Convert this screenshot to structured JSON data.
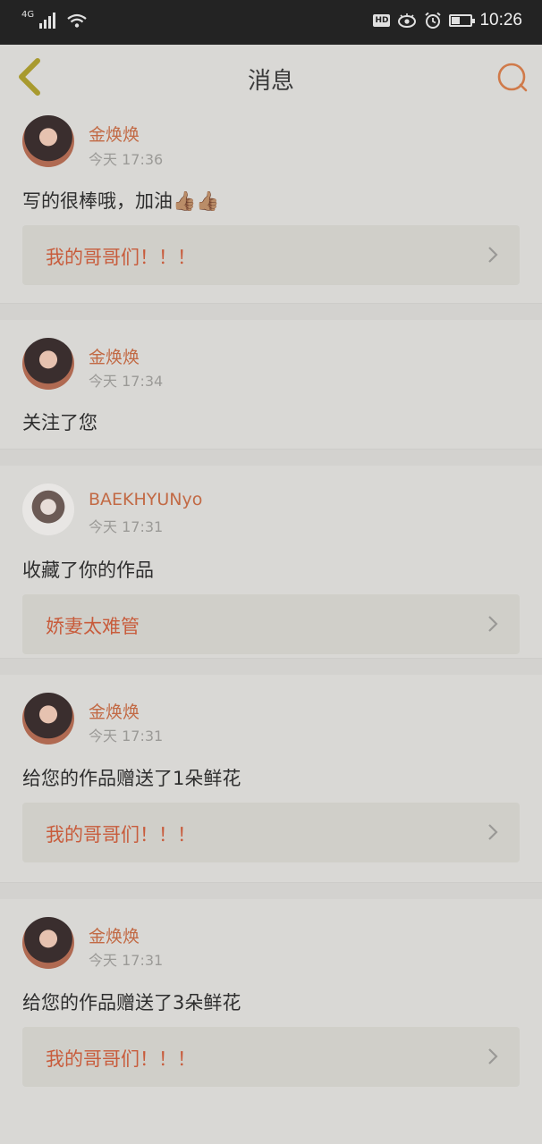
{
  "status_bar": {
    "network": "4G",
    "hd_badge": "HD",
    "time": "10:26"
  },
  "header": {
    "title": "消息"
  },
  "messages": [
    {
      "username": "金焕焕",
      "time": "今天 17:36",
      "text": "写的很棒哦，加油👍🏽👍🏽",
      "work_title": "我的哥哥们！！！"
    },
    {
      "username": "金焕焕",
      "time": "今天 17:34",
      "text": "关注了您"
    },
    {
      "username": "BAEKHYUNyo",
      "time": "今天 17:31",
      "text": "收藏了你的作品",
      "work_title": "娇妻太难管"
    },
    {
      "username": "金焕焕",
      "time": "今天 17:31",
      "text": "给您的作品赠送了1朵鲜花",
      "work_title": "我的哥哥们！！！"
    },
    {
      "username": "金焕焕",
      "time": "今天 17:31",
      "text": "给您的作品赠送了3朵鲜花",
      "work_title": "我的哥哥们！！！"
    }
  ],
  "colors": {
    "accent": "#c85c3c",
    "username": "#c26a45",
    "back_icon": "#a89a2e",
    "search_icon": "#d07a4a"
  }
}
